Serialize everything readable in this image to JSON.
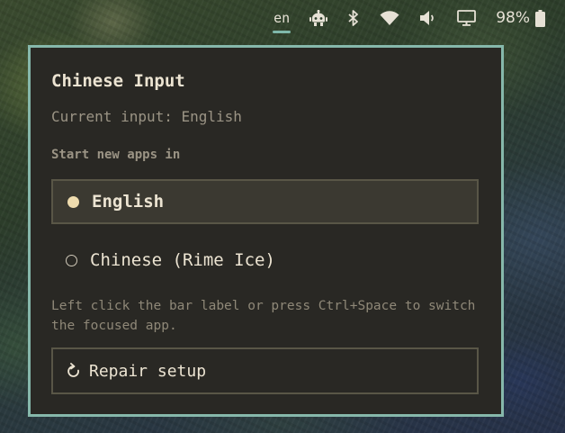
{
  "statusbar": {
    "language_indicator": "en",
    "battery_percent": "98%",
    "icons": [
      "robot-icon",
      "bluetooth-icon",
      "wifi-icon",
      "volume-icon",
      "display-icon",
      "battery-icon"
    ]
  },
  "popup": {
    "title": "Chinese Input",
    "current_input": "Current input: English",
    "section_label": "Start new apps in",
    "options": [
      {
        "label": "English",
        "selected": true
      },
      {
        "label": "Chinese (Rime Ice)",
        "selected": false
      }
    ],
    "hint": "Left click the bar label or press Ctrl+Space to switch the focused app.",
    "repair_label": "Repair setup"
  },
  "colors": {
    "accent_border": "#86b8ab",
    "popup_bg": "#292824",
    "selected_bg": "#3b3931",
    "text_primary": "#ece4d2",
    "text_muted": "#9b9485"
  }
}
